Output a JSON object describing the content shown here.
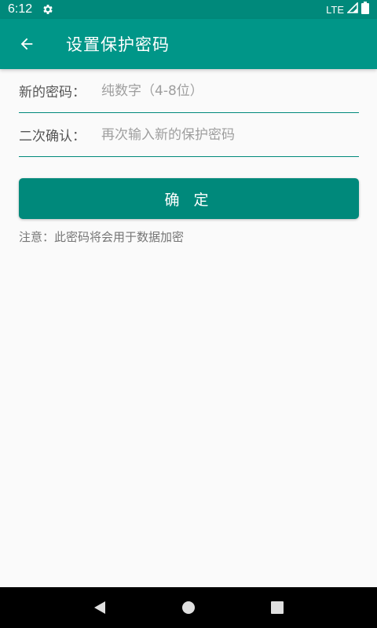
{
  "status_bar": {
    "time": "6:12",
    "network": "LTE",
    "icons": [
      "gear-icon",
      "signal-icon",
      "battery-icon"
    ]
  },
  "app_bar": {
    "title": "设置保护密码",
    "back_icon": "arrow-left-icon"
  },
  "form": {
    "new_password": {
      "label": "新的密码：",
      "value": "",
      "placeholder": "纯数字（4-8位）"
    },
    "confirm_password": {
      "label": "二次确认：",
      "value": "",
      "placeholder": "再次输入新的保护密码"
    }
  },
  "confirm_button": {
    "label": "确 定"
  },
  "note": "注意：此密码将会用于数据加密",
  "nav_bar": {
    "icons": [
      "back-triangle-icon",
      "home-circle-icon",
      "recents-square-icon"
    ]
  },
  "colors": {
    "primary": "#009688",
    "primary_dark": "#00897B",
    "background": "#FAFAFA"
  }
}
